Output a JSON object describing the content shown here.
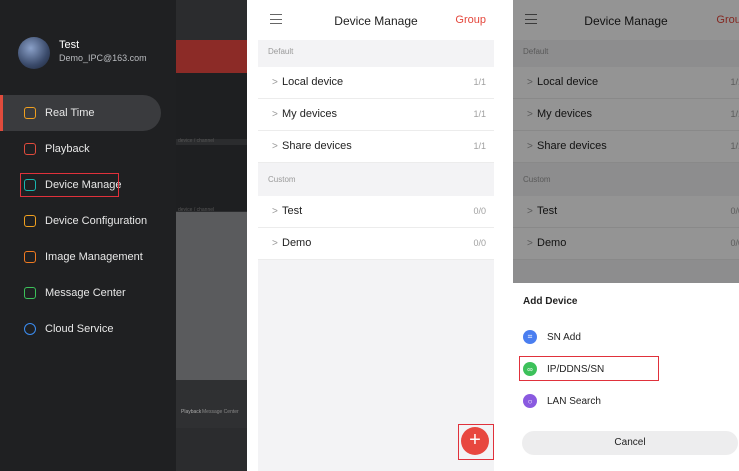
{
  "panel1": {
    "user": {
      "name": "Test",
      "email": "Demo_IPC@163.com"
    },
    "menu": [
      {
        "label": "Real Time",
        "icon": "play-icon",
        "color": "#f0a020"
      },
      {
        "label": "Playback",
        "icon": "film-icon",
        "color": "#e04b3c"
      },
      {
        "label": "Device Manage",
        "icon": "camera-icon",
        "color": "#19b7b0"
      },
      {
        "label": "Device Configuration",
        "icon": "config-icon",
        "color": "#f0a020"
      },
      {
        "label": "Image Management",
        "icon": "image-icon",
        "color": "#f07a20"
      },
      {
        "label": "Message Center",
        "icon": "message-icon",
        "color": "#3cc15a"
      },
      {
        "label": "Cloud Service",
        "icon": "cloud-icon",
        "color": "#3b8cf0"
      }
    ],
    "background": {
      "channel_label": "device / channel",
      "tab_playback": "Playback",
      "tab_message": "Message Center"
    }
  },
  "device_manage": {
    "title": "Device Manage",
    "group_button": "Group",
    "default_label": "Default",
    "custom_label": "Custom",
    "default_rows": [
      {
        "label": "Local device",
        "count": "1/1"
      },
      {
        "label": "My devices",
        "count": "1/1"
      },
      {
        "label": "Share devices",
        "count": "1/1"
      }
    ],
    "custom_rows": [
      {
        "label": "Test",
        "count": "0/0"
      },
      {
        "label": "Demo",
        "count": "0/0"
      }
    ],
    "fab_symbol": "+"
  },
  "add_device_sheet": {
    "title": "Add Device",
    "options": [
      {
        "label": "SN Add",
        "icon": "sn-icon",
        "color": "#4a7ef0"
      },
      {
        "label": "IP/DDNS/SN",
        "icon": "link-icon",
        "color": "#3cc15a"
      },
      {
        "label": "LAN Search",
        "icon": "search-icon",
        "color": "#8a5ae0"
      }
    ],
    "cancel": "Cancel"
  },
  "highlight_color": "#e0313b",
  "accent_color": "#e8473f"
}
